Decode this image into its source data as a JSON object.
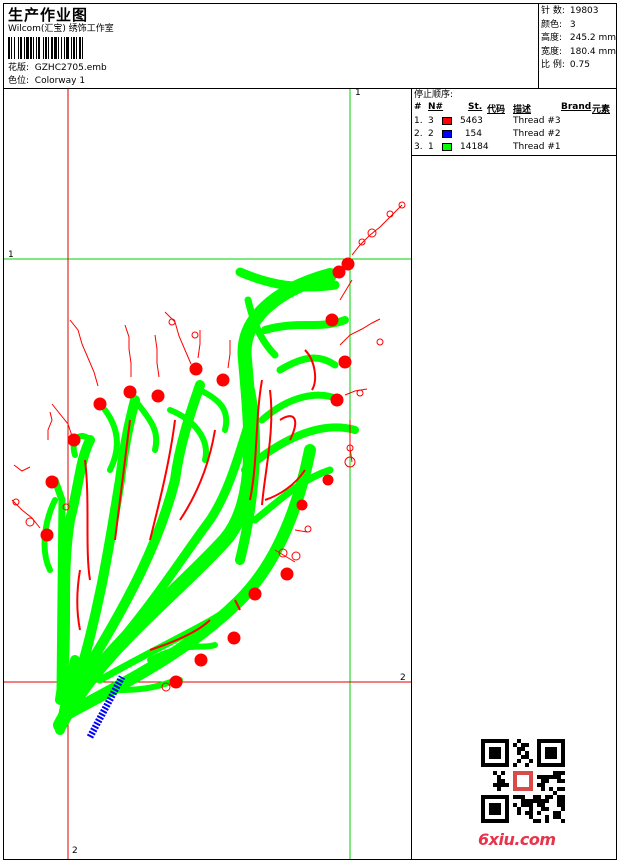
{
  "header": {
    "title": "生产作业图",
    "subtitle": "Wilcom(汇宝) 绣饰工作室",
    "design_label": "花版:",
    "design_value": "GZHC2705.emb",
    "colorway_label": "色位:",
    "colorway_value": "Colorway 1"
  },
  "stats": {
    "stitches_label": "针 数:",
    "stitches_value": "19803",
    "colors_label": "颜色:",
    "colors_value": "3",
    "height_label": "高度:",
    "height_value": "245.2 mm",
    "width_label": "宽度:",
    "width_value": "180.4 mm",
    "scale_label": "比 例:",
    "scale_value": "0.75"
  },
  "sequence": {
    "heading": "停止顺序:",
    "columns": {
      "num": "#",
      "needle": "N#",
      "stitches": "St.",
      "code": "代码",
      "desc": "描述",
      "brand": "Brand",
      "element": "元素"
    },
    "rows": [
      {
        "idx": "1.",
        "needle": "3",
        "color": "#ff0000",
        "stitches": "5463",
        "desc": "Thread #3"
      },
      {
        "idx": "2.",
        "needle": "2",
        "color": "#0000ff",
        "stitches": "154",
        "desc": "Thread #2"
      },
      {
        "idx": "3.",
        "needle": "1",
        "color": "#00ff00",
        "stitches": "14184",
        "desc": "Thread #1"
      }
    ]
  },
  "guides": {
    "v1": "1",
    "h1": "1",
    "h2": "2",
    "v2": "2"
  },
  "colors": {
    "thread1": "#00ff00",
    "thread2": "#0000ff",
    "thread3": "#ff0000"
  },
  "watermark": {
    "text": "6xiu.com",
    "qr_icon": "qr-code-icon"
  }
}
